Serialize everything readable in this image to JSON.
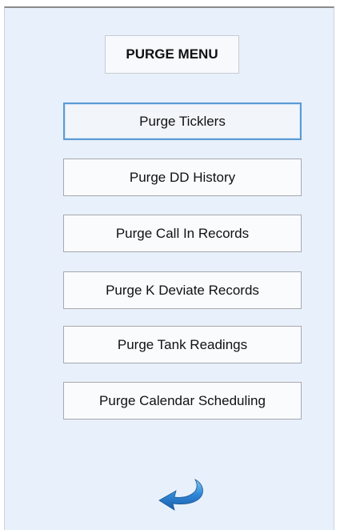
{
  "menu": {
    "title": "PURGE MENU",
    "buttons": [
      {
        "label": "Purge Ticklers",
        "focused": true
      },
      {
        "label": "Purge DD History"
      },
      {
        "label": "Purge Call In Records"
      },
      {
        "label": "Purge K Deviate Records"
      },
      {
        "label": "Purge Tank Readings"
      },
      {
        "label": "Purge Calendar Scheduling"
      }
    ]
  },
  "icons": {
    "return": "return-arrow-icon"
  },
  "colors": {
    "background": "#e8f0fb",
    "focus_border": "#5b9bd5",
    "arrow_blue": "#2f86d6"
  }
}
